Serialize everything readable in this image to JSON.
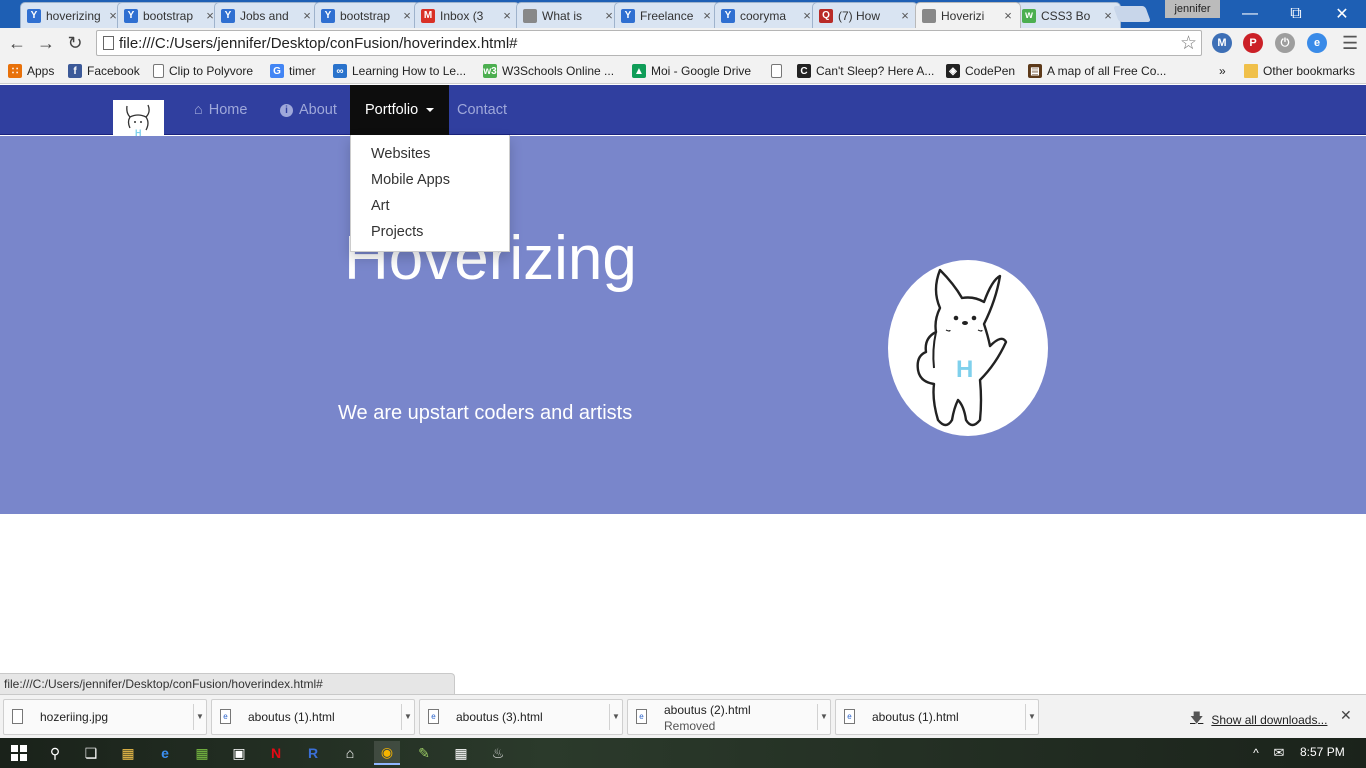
{
  "browser": {
    "tabs": [
      {
        "title": "hoverizing",
        "favicon": "y-icon",
        "color": "#2f6fd1"
      },
      {
        "title": "bootstrap",
        "favicon": "y-icon",
        "color": "#2f6fd1"
      },
      {
        "title": "Jobs and",
        "favicon": "y-icon",
        "color": "#2f6fd1"
      },
      {
        "title": "bootstrap",
        "favicon": "y-icon",
        "color": "#2f6fd1"
      },
      {
        "title": "Inbox (3",
        "favicon": "gmail-icon",
        "color": "#d93025"
      },
      {
        "title": "What is",
        "favicon": "page-icon",
        "color": "#888888"
      },
      {
        "title": "Freelance",
        "favicon": "y-icon",
        "color": "#2f6fd1"
      },
      {
        "title": "cooryma",
        "favicon": "y-icon",
        "color": "#2f6fd1"
      },
      {
        "title": "(7) How",
        "favicon": "quora-icon",
        "color": "#b92b27"
      },
      {
        "title": "Hoverizi",
        "favicon": "page-icon",
        "color": "#888888"
      },
      {
        "title": "CSS3 Bo",
        "favicon": "w3-icon",
        "color": "#4caf50"
      }
    ],
    "user": "jennifer",
    "url": "file:///C:/Users/jennifer/Desktop/conFusion/hoverindex.html#",
    "bookmarks": [
      {
        "label": "Apps",
        "icon": "apps-icon",
        "color": "#e8710a"
      },
      {
        "label": "Facebook",
        "icon": "facebook-icon",
        "color": "#3b5998"
      },
      {
        "label": "Clip to Polyvore",
        "icon": "page-icon",
        "color": "#888888"
      },
      {
        "label": "timer",
        "icon": "google-icon",
        "color": "#4285f4"
      },
      {
        "label": "Learning How to Le...",
        "icon": "coursera-icon",
        "color": "#2a73cc"
      },
      {
        "label": "W3Schools Online ...",
        "icon": "w3-icon",
        "color": "#4caf50"
      },
      {
        "label": "Moi - Google Drive",
        "icon": "drive-icon",
        "color": "#0f9d58"
      },
      {
        "label": "",
        "icon": "page-icon",
        "color": "#888888"
      },
      {
        "label": "Can't Sleep? Here A...",
        "icon": "c-icon",
        "color": "#222222"
      },
      {
        "label": "CodePen",
        "icon": "codepen-icon",
        "color": "#222222"
      },
      {
        "label": "A map of all Free Co...",
        "icon": "book-icon",
        "color": "#5d3a1a"
      }
    ],
    "bookmarks_overflow": "»",
    "other_bookmarks": "Other bookmarks",
    "status_url": "file:///C:/Users/jennifer/Desktop/conFusion/hoverindex.html#"
  },
  "site": {
    "nav": {
      "home": "Home",
      "about": "About",
      "portfolio": "Portfolio",
      "contact": "Contact"
    },
    "dropdown": [
      "Websites",
      "Mobile Apps",
      "Art",
      "Projects"
    ],
    "hero": {
      "title": "Hoverizing",
      "subtitle": "We are upstart coders and artists",
      "logo_letter": "H"
    },
    "colors": {
      "navbar": "#303f9f",
      "jumbotron": "#7986cb",
      "active_nav": "#0d0d0d",
      "logo_letter": "#7fd0ec"
    }
  },
  "downloads": {
    "items": [
      {
        "name": "hozeriing.jpg",
        "sub": ""
      },
      {
        "name": "aboutus (1).html",
        "sub": ""
      },
      {
        "name": "aboutus (3).html",
        "sub": ""
      },
      {
        "name": "aboutus (2).html",
        "sub": "Removed"
      },
      {
        "name": "aboutus (1).html",
        "sub": ""
      }
    ],
    "show_all": "Show all downloads..."
  },
  "taskbar": {
    "time": "8:57 PM"
  }
}
